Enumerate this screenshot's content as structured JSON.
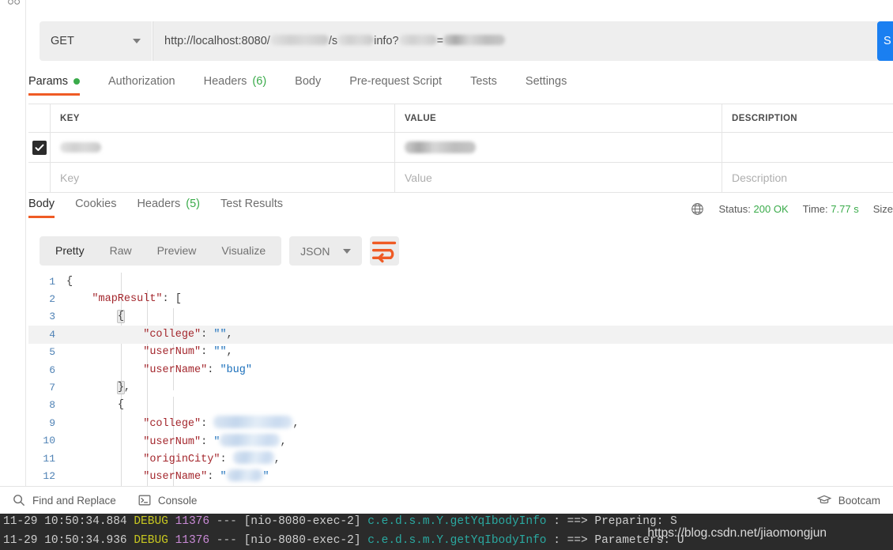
{
  "request": {
    "method": "GET",
    "url_prefix": "http://localhost:8080/",
    "url_mid": "/s",
    "url_mid2": "info?",
    "url_eq": "=",
    "send_label": "S",
    "tabs": [
      {
        "label": "Params",
        "active": true,
        "dot": true
      },
      {
        "label": "Authorization",
        "active": false
      },
      {
        "label": "Headers",
        "count": "(6)",
        "active": false
      },
      {
        "label": "Body",
        "active": false
      },
      {
        "label": "Pre-request Script",
        "active": false
      },
      {
        "label": "Tests",
        "active": false
      },
      {
        "label": "Settings",
        "active": false
      }
    ]
  },
  "params": {
    "columns": [
      "KEY",
      "VALUE",
      "DESCRIPTION"
    ],
    "rows": [
      {
        "checked": true,
        "key": "",
        "value": "",
        "description": ""
      }
    ],
    "placeholders": {
      "key": "Key",
      "value": "Value",
      "description": "Description"
    }
  },
  "response": {
    "tabs": [
      {
        "label": "Body",
        "active": true
      },
      {
        "label": "Cookies",
        "active": false
      },
      {
        "label": "Headers",
        "count": "(5)",
        "active": false
      },
      {
        "label": "Test Results",
        "active": false
      }
    ],
    "status_label": "Status:",
    "status_value": "200 OK",
    "time_label": "Time:",
    "time_value": "7.77 s",
    "size_label": "Size",
    "format_tabs": [
      {
        "label": "Pretty",
        "active": true
      },
      {
        "label": "Raw",
        "active": false
      },
      {
        "label": "Preview",
        "active": false
      },
      {
        "label": "Visualize",
        "active": false
      }
    ],
    "format_type": "JSON",
    "body_lines": [
      {
        "n": "1",
        "indent": 0,
        "html": "{"
      },
      {
        "n": "2",
        "indent": 1,
        "html": "\"mapResult\": ["
      },
      {
        "n": "3",
        "indent": 2,
        "html": "{"
      },
      {
        "n": "4",
        "indent": 3,
        "html": "\"college\": \"\","
      },
      {
        "n": "5",
        "indent": 3,
        "html": "\"userNum\": \"\","
      },
      {
        "n": "6",
        "indent": 3,
        "html": "\"userName\": \"bug\""
      },
      {
        "n": "7",
        "indent": 2,
        "html": "},"
      },
      {
        "n": "8",
        "indent": 2,
        "html": "{"
      },
      {
        "n": "9",
        "indent": 3,
        "html": "\"college\": [redacted],"
      },
      {
        "n": "10",
        "indent": 3,
        "html": "\"userNum\": \"[redacted]\","
      },
      {
        "n": "11",
        "indent": 3,
        "html": "\"originCity\": [redacted],"
      },
      {
        "n": "12",
        "indent": 3,
        "html": "\"userName\": \"[redacted]\""
      }
    ]
  },
  "bottom_bar": {
    "find_replace": "Find and Replace",
    "console": "Console",
    "bootcamp": "Bootcam"
  },
  "console_log": {
    "lines": [
      {
        "date": "11-29 10:50:34.884",
        "level": "DEBUG",
        "pid": "11376",
        "dash": "---",
        "thread": "[nio-8080-exec-2]",
        "logger": "c.e.d.s.m.Y.getYqIbodyInfo",
        "msg": ": ==>  Preparing: S"
      },
      {
        "date": "11-29 10:50:34.936",
        "level": "DEBUG",
        "pid": "11376",
        "dash": "---",
        "thread": "[nio-8080-exec-2]",
        "logger": "c.e.d.s.m.Y.getYqIbodyInfo",
        "msg": ": ==> Parameters: U"
      }
    ],
    "watermark": "https://blog.csdn.net/jiaomongjun"
  },
  "colors": {
    "accent": "#ef5b25",
    "send": "#1a7ff1",
    "ok": "#3aab4a"
  }
}
